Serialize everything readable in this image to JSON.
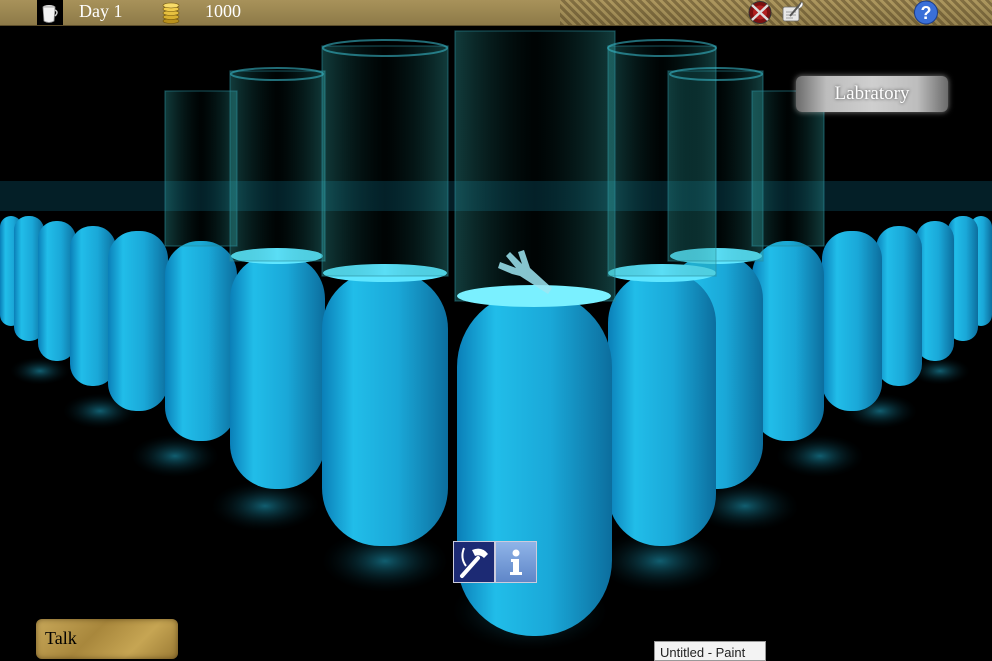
{
  "status_bar": {
    "day_label": "Day 1",
    "gold_amount": "1000"
  },
  "location": {
    "name": "Labratory"
  },
  "actions": {
    "build_icon": "hammer-icon",
    "info_icon": "info-icon"
  },
  "talk": {
    "label": "Talk"
  },
  "taskbar_tooltip": {
    "text": "Untitled - Paint"
  },
  "colors": {
    "bar": "#a8925a",
    "liquid": "#29c8f0",
    "glow": "#6ff0ff"
  }
}
